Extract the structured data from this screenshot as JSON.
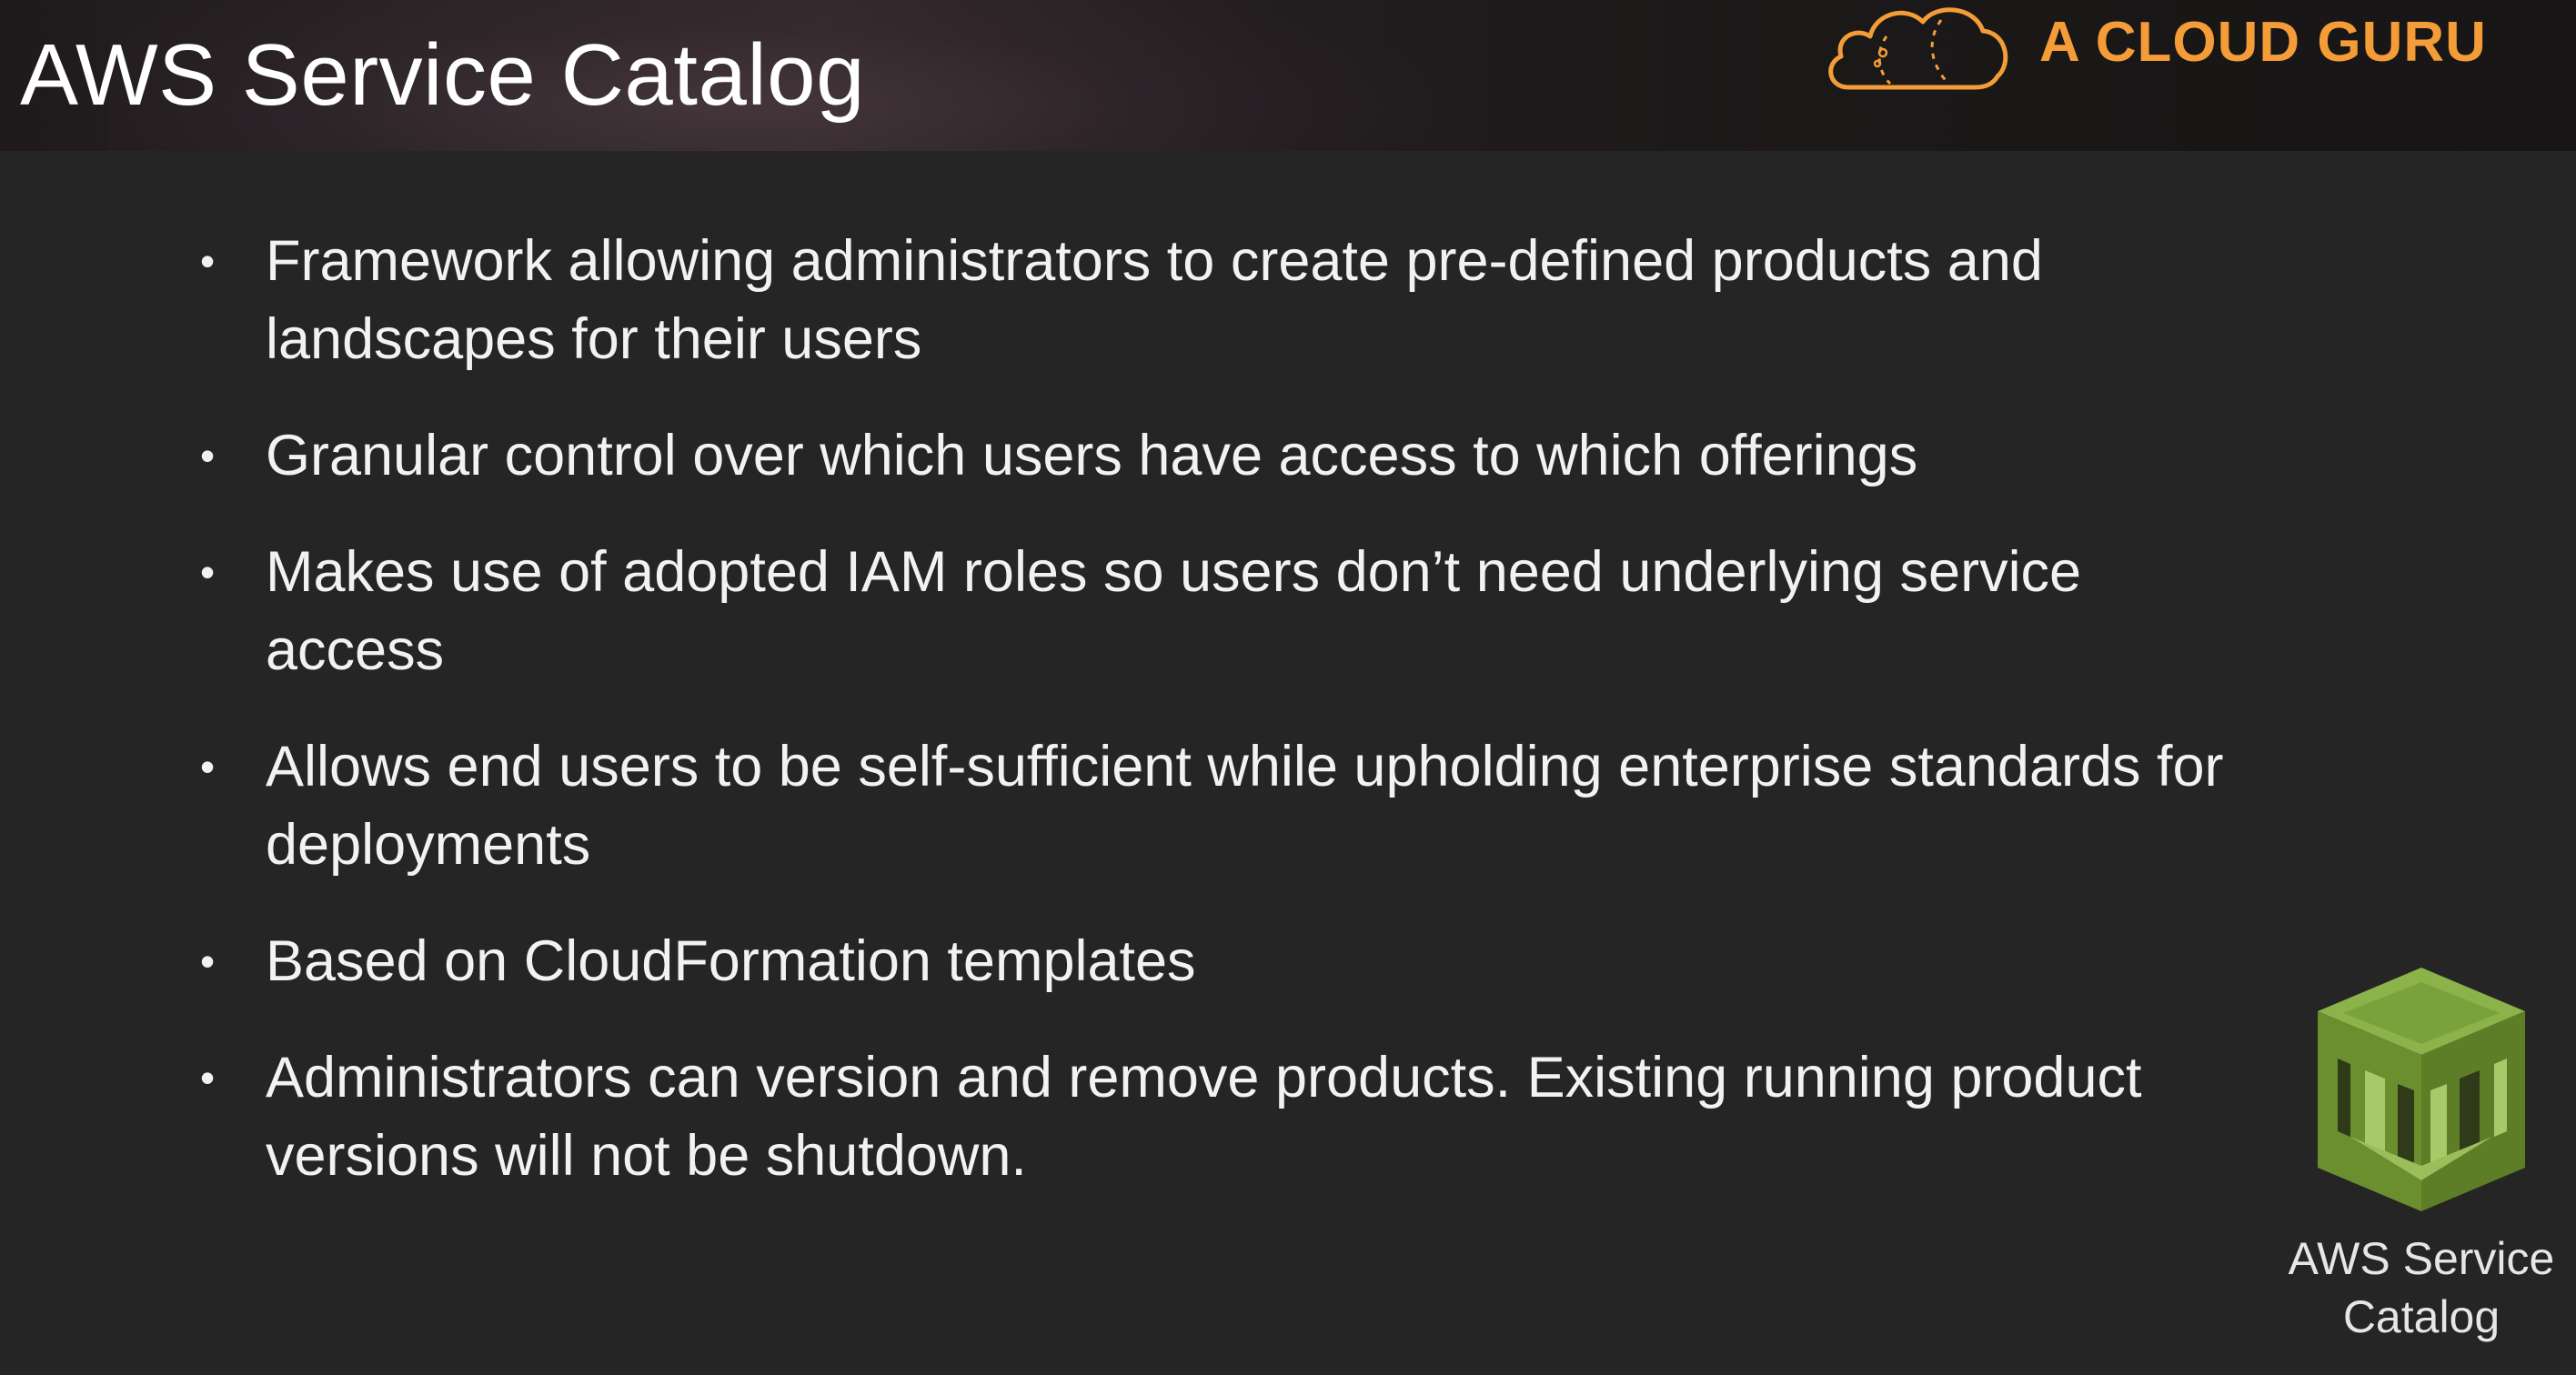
{
  "slide": {
    "title": "AWS Service Catalog",
    "brand_name": "A CLOUD GURU",
    "bullet_glyph": "•",
    "bullets": [
      "Framework allowing administrators to create pre-defined products and landscapes for their users",
      "Granular control over which users have access to which offerings",
      "Makes use of adopted IAM roles so users don’t need underlying service access",
      "Allows end users to be self-sufficient while upholding enterprise standards for deployments",
      "Based on CloudFormation templates",
      "Administrators can version and remove products.  Existing running product versions will not be shutdown."
    ],
    "service_icon_label_line1": "AWS Service",
    "service_icon_label_line2": "Catalog"
  },
  "icons": {
    "brand_logo": "cloud-logo-icon",
    "service_icon": "aws-service-catalog-icon"
  },
  "colors": {
    "background": "#252526",
    "brand_orange": "#f39c38",
    "service_green": "#6b8e2f",
    "text": "#f2f2f2"
  }
}
